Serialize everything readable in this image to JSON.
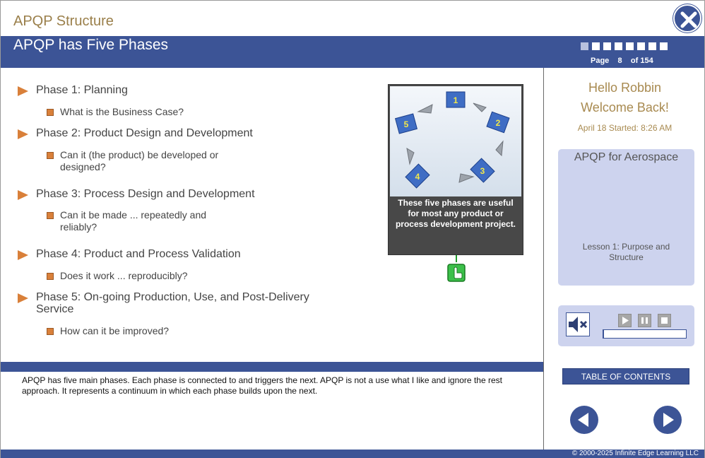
{
  "course_title": "APQP Structure",
  "slide_title": "APQP has Five Phases",
  "page": {
    "label": "Page",
    "current": "8",
    "of_label": "of",
    "total": "154",
    "progress_dots": 8
  },
  "phases": [
    {
      "title": "Phase 1: Planning",
      "question": "What is the Business Case?"
    },
    {
      "title": "Phase 2: Product Design and Development",
      "question": "Can it (the product) be developed or designed?"
    },
    {
      "title": "Phase 3: Process Design and Development",
      "question": "Can it be made ... repeatedly and reliably?"
    },
    {
      "title": "Phase 4: Product and Process Validation",
      "question": "Does it work ... reproducibly?"
    },
    {
      "title": "Phase 5: On-going Production, Use, and Post-Delivery Service",
      "question": "How can it be improved?"
    }
  ],
  "figure": {
    "caption": "These five phases are useful for most any product or process development project.",
    "cycle_numbers": [
      "1",
      "2",
      "3",
      "4",
      "5"
    ]
  },
  "notes": "APQP has five main phases. Each phase is connected to and triggers the next. APQP is not a use what I like and ignore the rest approach. It represents a continuum in which each phase builds upon the next.",
  "greeting": {
    "hello": "Hello Robbin",
    "welcome": "Welcome Back!",
    "started": "April 18 Started: 8:26 AM"
  },
  "lesson": {
    "course": "APQP for Aerospace",
    "name": "Lesson 1: Purpose and Structure"
  },
  "audio": {
    "progress": 0.01
  },
  "toc_label": "TABLE OF CONTENTS",
  "copyright": "© 2000-2025 Infinite Edge Learning LLC",
  "colors": {
    "brand_blue": "#3c5496",
    "accent_orange": "#d9803a",
    "gold_text": "#9a7f4a",
    "panel_bg": "#cdd3ee"
  }
}
